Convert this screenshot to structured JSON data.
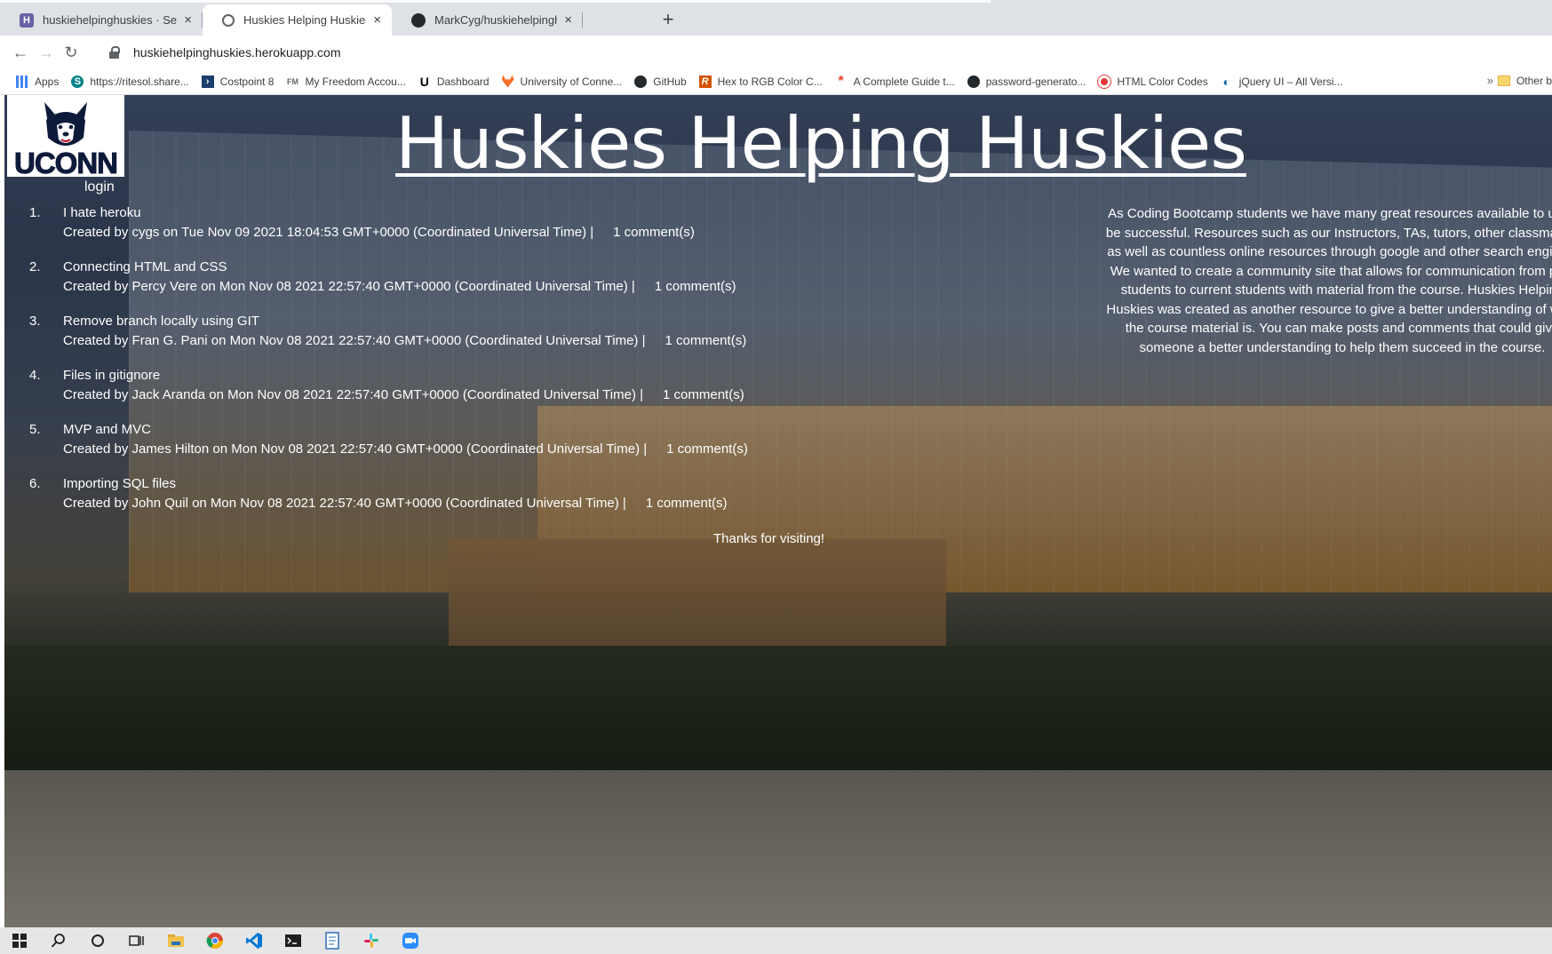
{
  "browser": {
    "tabs": [
      {
        "label": "huskiehelpinghuskies · Settings |",
        "favicon": "heroku-icon",
        "active": false
      },
      {
        "label": "Huskies Helping Huskies",
        "favicon": "globe-icon",
        "active": true
      },
      {
        "label": "MarkCyg/huskiehelpinghuskies",
        "favicon": "github-icon",
        "active": false
      }
    ],
    "close_glyph": "×",
    "new_tab_glyph": "+",
    "url": "huskiehelpinghuskies.herokuapp.com",
    "bookmarks": [
      {
        "label": "Apps",
        "icon": "apps-grid-icon"
      },
      {
        "label": "https://ritesol.share...",
        "icon": "sharepoint-icon"
      },
      {
        "label": "Costpoint 8",
        "icon": "costpoint-icon"
      },
      {
        "label": "My Freedom Accou...",
        "icon": "fm-icon"
      },
      {
        "label": "Dashboard",
        "icon": "u-icon"
      },
      {
        "label": "University of Conne...",
        "icon": "gitlab-icon"
      },
      {
        "label": "GitHub",
        "icon": "github-icon"
      },
      {
        "label": "Hex to RGB Color C...",
        "icon": "r-icon"
      },
      {
        "label": "A Complete Guide t...",
        "icon": "asterisk-icon"
      },
      {
        "label": "password-generato...",
        "icon": "github-icon"
      },
      {
        "label": "HTML Color Codes",
        "icon": "red-dot-icon"
      },
      {
        "label": "jQuery UI – All Versi...",
        "icon": "jquery-icon"
      }
    ],
    "more_glyph": "»",
    "other_bookmarks": "Other b"
  },
  "page": {
    "logo_text": "UCONN",
    "title": "Huskies Helping Huskies",
    "login": "login",
    "posts": [
      {
        "n": "1.",
        "title": "I hate heroku",
        "meta": "Created by cygs on Tue Nov 09 2021 18:04:53 GMT+0000 (Coordinated Universal Time) |",
        "comments": "1 comment(s)"
      },
      {
        "n": "2.",
        "title": "Connecting HTML and CSS",
        "meta": "Created by Percy Vere on Mon Nov 08 2021 22:57:40 GMT+0000 (Coordinated Universal Time) |",
        "comments": "1 comment(s)"
      },
      {
        "n": "3.",
        "title": "Remove branch locally using GIT",
        "meta": "Created by Fran G. Pani on Mon Nov 08 2021 22:57:40 GMT+0000 (Coordinated Universal Time) |",
        "comments": "1 comment(s)"
      },
      {
        "n": "4.",
        "title": "Files in gitignore",
        "meta": "Created by Jack Aranda on Mon Nov 08 2021 22:57:40 GMT+0000 (Coordinated Universal Time) |",
        "comments": "1 comment(s)"
      },
      {
        "n": "5.",
        "title": "MVP and MVC",
        "meta": "Created by James Hilton on Mon Nov 08 2021 22:57:40 GMT+0000 (Coordinated Universal Time) |",
        "comments": "1 comment(s)"
      },
      {
        "n": "6.",
        "title": "Importing SQL files",
        "meta": "Created by John Quil on Mon Nov 08 2021 22:57:40 GMT+0000 (Coordinated Universal Time) |",
        "comments": "1 comment(s)"
      }
    ],
    "thanks": "Thanks for visiting!",
    "about": "As Coding Bootcamp students we have many great resources available to us to be successful. Resources such as our Instructors, TAs, tutors, other classmates, as well as countless online resources through google and other search engines. We wanted to create a community site that allows for communication from past students to current students with material from the course. Huskies Helping Huskies was created as another resource to give a better understanding of what the course material is. You can make posts and comments that could give someone a better understanding to help them succeed in the course."
  },
  "taskbar": {
    "items": [
      "windows-start-icon",
      "search-icon",
      "cortana-icon",
      "task-view-icon",
      "file-explorer-icon",
      "chrome-icon",
      "vscode-icon",
      "terminal-icon",
      "notepad-icon",
      "slack-icon",
      "zoom-icon"
    ]
  },
  "colors": {
    "title_text": "#ffffff",
    "logo_navy": "#0e1a3a",
    "tabbar_bg": "#dee1e6",
    "taskbar_bg": "#e6e6e6"
  }
}
